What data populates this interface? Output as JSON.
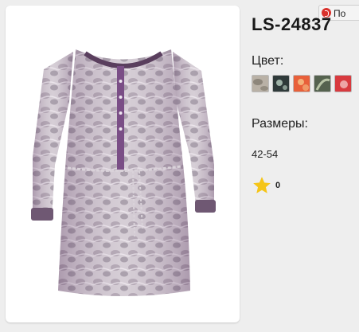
{
  "product": {
    "sku": "LS-24837",
    "color_label": "Цвет:",
    "size_label": "Размеры:",
    "sizes": "42-54",
    "rating_count": "0",
    "share_label": "По"
  },
  "swatches": [
    {
      "name": "beige-python",
      "color": "#b9b1a6",
      "accent": "#7b7469"
    },
    {
      "name": "dark-floral",
      "color": "#2f3a3a",
      "accent": "#9fb3a8"
    },
    {
      "name": "orange-floral",
      "color": "#e8603a",
      "accent": "#f3b27a"
    },
    {
      "name": "green-leaf",
      "color": "#55624f",
      "accent": "#b8c4a6"
    },
    {
      "name": "red-rose",
      "color": "#d83a3f",
      "accent": "#f2c1c0"
    }
  ],
  "colors": {
    "star": "#f5c518",
    "share_icon": "#d9312b"
  }
}
